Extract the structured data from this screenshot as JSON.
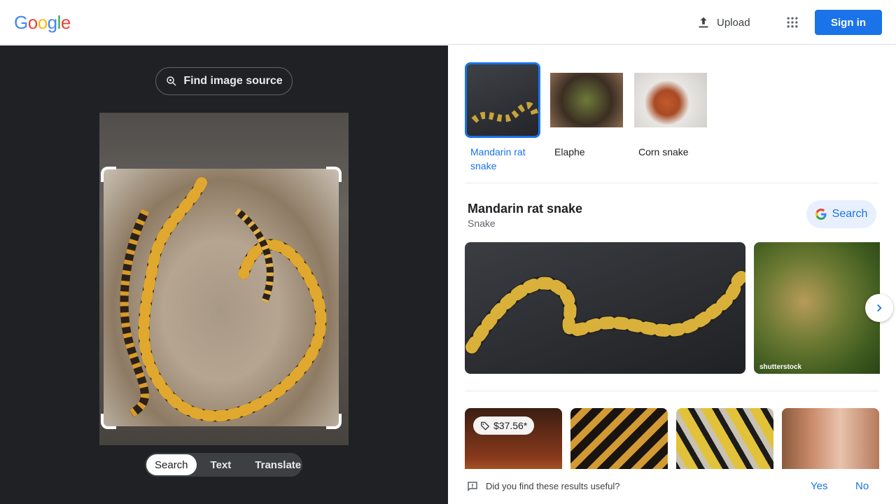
{
  "header": {
    "logo": [
      "G",
      "o",
      "o",
      "g",
      "l",
      "e"
    ],
    "logo_colors": [
      "#4285f4",
      "#ea4335",
      "#fbbc05",
      "#4285f4",
      "#34a853",
      "#ea4335"
    ],
    "upload_label": "Upload",
    "signin_label": "Sign in",
    "apps_icon": "apps-grid-icon"
  },
  "left": {
    "find_source_label": "Find image source",
    "tabs": [
      {
        "label": "Search",
        "active": true
      },
      {
        "label": "Text",
        "active": false
      },
      {
        "label": "Translate",
        "active": false
      }
    ]
  },
  "right": {
    "thumbs": [
      {
        "label": "Mandarin rat snake",
        "selected": true
      },
      {
        "label": "Elaphe",
        "selected": false
      },
      {
        "label": "Corn snake",
        "selected": false
      }
    ],
    "entity": {
      "title": "Mandarin rat snake",
      "subtitle": "Snake",
      "search_label": "Search"
    },
    "watermark": "shutterstock",
    "price_badge": "$37.56*",
    "feedback": {
      "question": "Did you find these results useful?",
      "yes": "Yes",
      "no": "No"
    }
  },
  "colors": {
    "accent": "#1a73e8",
    "dark_panel": "#202124"
  }
}
